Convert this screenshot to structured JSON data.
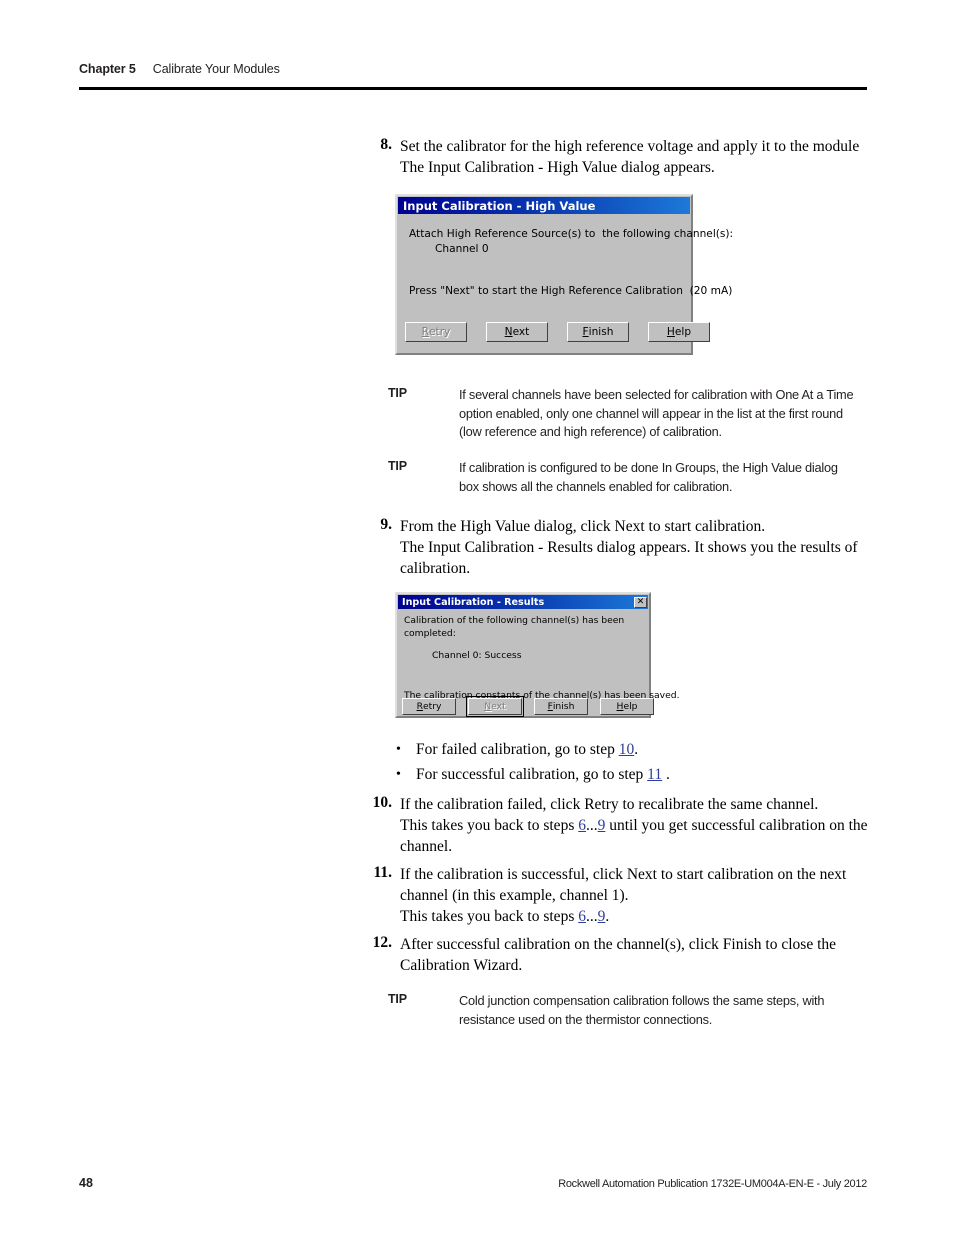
{
  "header": {
    "chapter": "Chapter 5",
    "title": "Calibrate Your Modules"
  },
  "steps": {
    "step8": {
      "number": "8.",
      "line1": "Set the calibrator for the high reference voltage and apply it to the module",
      "line2": "The Input Calibration - High Value dialog appears."
    },
    "step9": {
      "number": "9.",
      "line1": "From the High Value dialog, click Next to start calibration.",
      "line2": "The Input Calibration - Results dialog appears. It shows you the results of",
      "line3": "calibration."
    },
    "step10": {
      "number": "10.",
      "line1": "If the calibration failed, click Retry to recalibrate the same channel.",
      "line2_a": "This takes you back to steps ",
      "line2_ref1": "6",
      "line2_b": "...",
      "line2_ref2": "9",
      "line2_c": " until you get successful calibration on the",
      "line3": "channel."
    },
    "step11": {
      "number": "11.",
      "line1": "If the calibration is successful, click Next to start calibration on the next",
      "line2": "channel (in this example, channel 1).",
      "line3_a": "This takes you back to steps ",
      "line3_ref1": "6",
      "line3_b": "...",
      "line3_ref2": "9",
      "line3_c": "."
    },
    "step12": {
      "number": "12.",
      "line1": "After successful calibration on the channel(s), click Finish to close the",
      "line2": "Calibration Wizard."
    }
  },
  "bullets": {
    "item1_a": "For failed calibration, go to step ",
    "item1_ref": "10",
    "item1_b": ".",
    "item2_a": "For successful calibration, go to step ",
    "item2_ref": "11",
    "item2_b": " ."
  },
  "tips": {
    "tip1": {
      "label": "TIP",
      "line1": "If several channels have been selected for calibration with One At a Time",
      "line2": "option enabled, only one channel will appear in the list at the first round",
      "line3": "(low reference and high reference) of calibration."
    },
    "tip2": {
      "label": "TIP",
      "line1": "If calibration is configured to be done In Groups, the High Value dialog",
      "line2": "box shows all the channels enabled for calibration."
    },
    "tip3": {
      "label": "TIP",
      "line1": "Cold junction compensation calibration follows the same steps, with",
      "line2": "resistance used on the thermistor connections."
    }
  },
  "dialog_high_value": {
    "title": "Input Calibration - High Value",
    "body_line1": "Attach High Reference Source(s) to  the following channel(s):",
    "body_line2": "Channel 0",
    "body_line3": "Press \"Next\" to start the High Reference Calibration  (20 mA)",
    "buttons": [
      {
        "label": "Retry",
        "accel": "R",
        "rest": "etry",
        "state": "disabled"
      },
      {
        "label": "Next",
        "accel": "N",
        "rest": "ext",
        "state": "enabled"
      },
      {
        "label": "Finish",
        "accel": "F",
        "rest": "inish",
        "state": "enabled"
      },
      {
        "label": "Help",
        "accel": "H",
        "rest": "elp",
        "state": "enabled"
      }
    ]
  },
  "dialog_results": {
    "title": "Input Calibration - Results",
    "close_icon": "close-icon",
    "close_glyph": "✕",
    "body_line1": "Calibration of the following channel(s) has been",
    "body_line2": "completed:",
    "body_line3": "Channel 0: Success",
    "body_line4": "The calibration constants of the channel(s) has been saved.",
    "buttons": [
      {
        "label": "Retry",
        "accel": "R",
        "rest": "etry",
        "state": "enabled"
      },
      {
        "label": "Next",
        "accel": "N",
        "rest": "ext",
        "state": "disabled"
      },
      {
        "label": "Finish",
        "accel": "F",
        "rest": "inish",
        "state": "enabled"
      },
      {
        "label": "Help",
        "accel": "H",
        "rest": "elp",
        "state": "enabled"
      }
    ]
  },
  "footer": {
    "page_number": "48",
    "publication": "Rockwell Automation Publication 1732E-UM004A-EN-E - July 2012"
  },
  "colors": {
    "title_bar_start": "#00008f",
    "title_bar_end": "#1e79d8",
    "dialog_face": "#c0c0c0",
    "xref_link": "#2c3e9b",
    "text": "#231f20"
  }
}
